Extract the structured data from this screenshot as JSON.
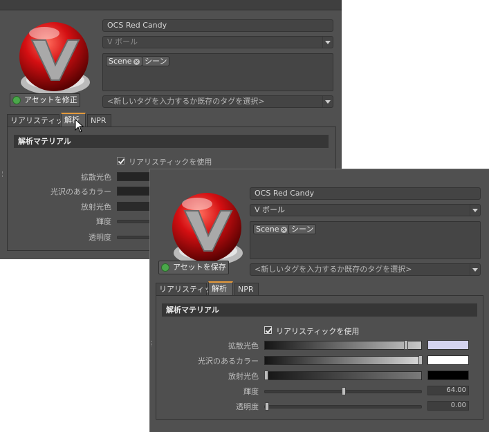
{
  "back": {
    "material_name": "OCS Red Candy",
    "shape": "V ボール",
    "tags": [
      {
        "label": "Scene"
      },
      {
        "label": "シーン"
      }
    ],
    "tag_placeholder": "<新しいタグを入力するか既存のタグを選択>",
    "asset_button": "アセットを修正",
    "tabs": [
      "リアリスティック",
      "解析",
      "NPR"
    ],
    "section_title": "解析マテリアル",
    "use_realistic": "リアリスティックを使用",
    "props": [
      "拡散光色",
      "光沢のあるカラー",
      "放射光色",
      "輝度",
      "透明度"
    ]
  },
  "front": {
    "material_name": "OCS Red Candy",
    "shape": "V ボール",
    "tags": [
      {
        "label": "Scene"
      },
      {
        "label": "シーン"
      }
    ],
    "tag_placeholder": "<新しいタグを入力するか既存のタグを選択>",
    "asset_button": "アセットを保存",
    "tabs": [
      "リアリスティック",
      "解析",
      "NPR"
    ],
    "section_title": "解析マテリアル",
    "use_realistic": "リアリスティックを使用",
    "props": [
      "拡散光色",
      "光沢のあるカラー",
      "放射光色",
      "輝度",
      "透明度"
    ],
    "brightness_value": "64.00",
    "transparency_value": "0.00",
    "brightness_level": 0.5,
    "transparency_level": 0.0
  },
  "colors": {
    "accent_tab": "#e59a3c",
    "diffuse_swatch": "#d4d3ef",
    "glossy_swatch": "#ffffff",
    "emissive_swatch": "#000000",
    "ball_red": "#d40f12"
  },
  "icons": {
    "asset_icon": "green-circle-refresh-icon",
    "dropdown": "chevron-down-icon",
    "tag_remove": "close-icon",
    "cursor": "mouse-pointer-icon"
  }
}
